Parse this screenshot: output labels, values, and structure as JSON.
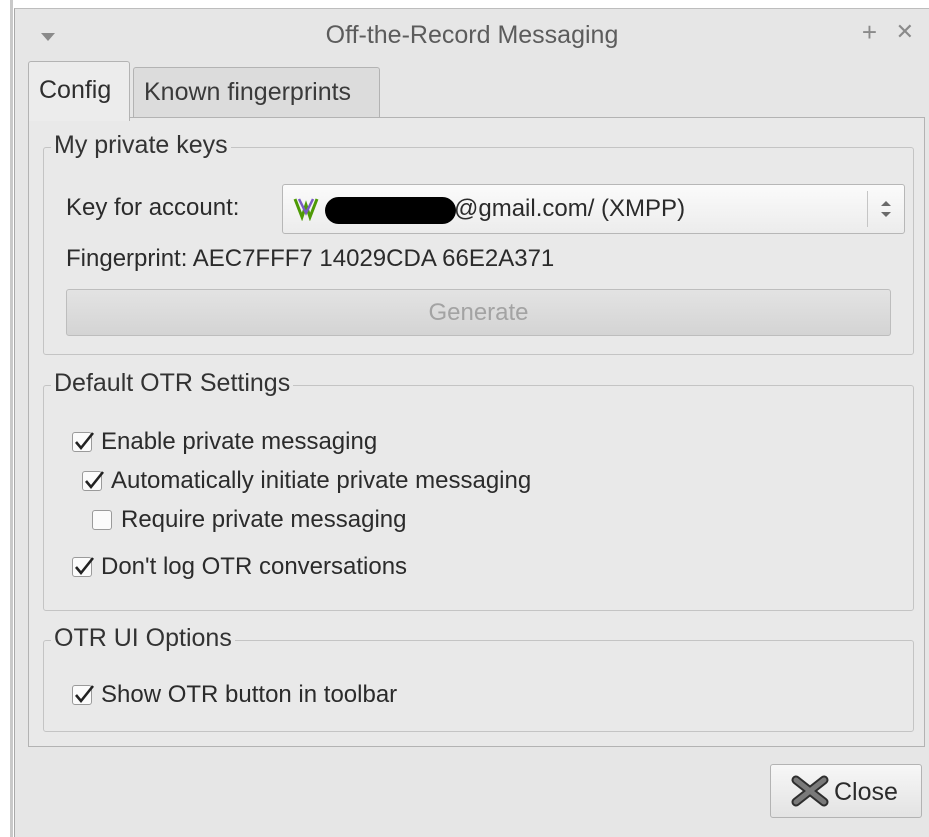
{
  "window": {
    "title": "Off-the-Record Messaging",
    "controls": {
      "menu_icon": "chevron-down-icon",
      "pin_icon": "plus-icon",
      "close_icon": "close-icon"
    }
  },
  "tabs": [
    {
      "label": "Config",
      "active": true
    },
    {
      "label": "Known fingerprints",
      "active": false
    }
  ],
  "private_keys": {
    "group_label": "My private keys",
    "account_label": "Key for account:",
    "account_value": "@gmail.com/ (XMPP)",
    "account_icon": "vacuum-xmpp-icon",
    "fingerprint": "Fingerprint: AEC7FFF7 14029CDA 66E2A371",
    "generate_label": "Generate"
  },
  "default_settings": {
    "group_label": "Default OTR Settings",
    "options": [
      {
        "label": "Enable private messaging",
        "checked": true
      },
      {
        "label": "Automatically initiate private messaging",
        "checked": true
      },
      {
        "label": "Require private messaging",
        "checked": false
      },
      {
        "label": "Don't log OTR conversations",
        "checked": true
      }
    ]
  },
  "ui_options": {
    "group_label": "OTR UI Options",
    "options": [
      {
        "label": "Show OTR button in toolbar",
        "checked": true
      }
    ]
  },
  "footer": {
    "close_label": "Close"
  },
  "colors": {
    "window_bg": "#e6e6e6",
    "panel_bg": "#e9e9e9",
    "disabled_text": "#a3a3a3"
  }
}
